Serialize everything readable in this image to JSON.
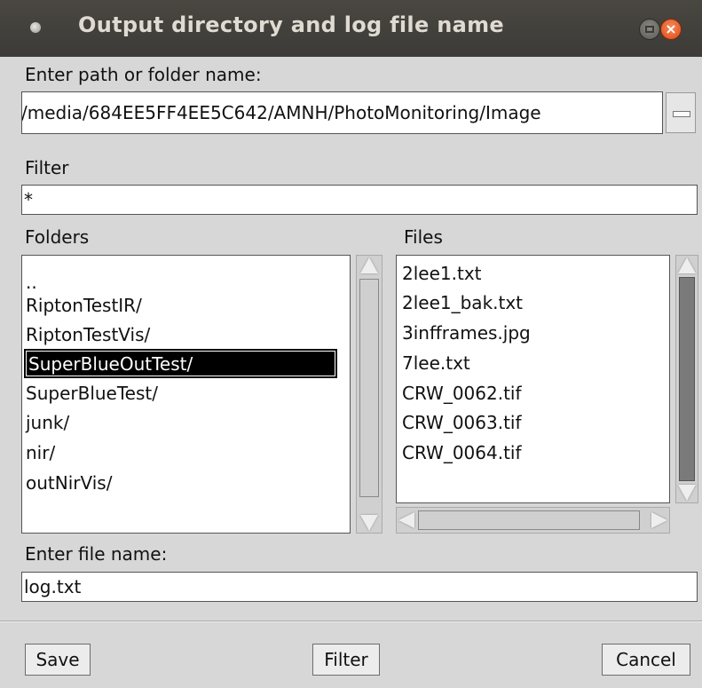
{
  "window": {
    "title": "Output directory and log file name",
    "close_glyph": "×"
  },
  "path": {
    "label": "Enter path or folder name:",
    "value": "/media/684EE5FF4EE5C642/AMNH/PhotoMonitoring/Image"
  },
  "filter": {
    "label": "Filter",
    "value": "*"
  },
  "folders": {
    "label": "Folders",
    "items": [
      "..",
      "RiptonTestIR/",
      "RiptonTestVis/",
      "SuperBlueOutTest/",
      "SuperBlueTest/",
      "junk/",
      "nir/",
      "outNirVis/"
    ],
    "selected": "SuperBlueOutTest/"
  },
  "files": {
    "label": "Files",
    "items": [
      "2lee1.txt",
      "2lee1_bak.txt",
      "3infframes.jpg",
      "7lee.txt",
      "CRW_0062.tif",
      "CRW_0063.tif",
      "CRW_0064.tif"
    ]
  },
  "filename": {
    "label": "Enter file name:",
    "value": "log.txt"
  },
  "buttons": {
    "save": "Save",
    "filter": "Filter",
    "cancel": "Cancel"
  },
  "colors": {
    "titlebar": "#3c3b37",
    "close_button": "#df4a16",
    "selection": "#000000"
  }
}
